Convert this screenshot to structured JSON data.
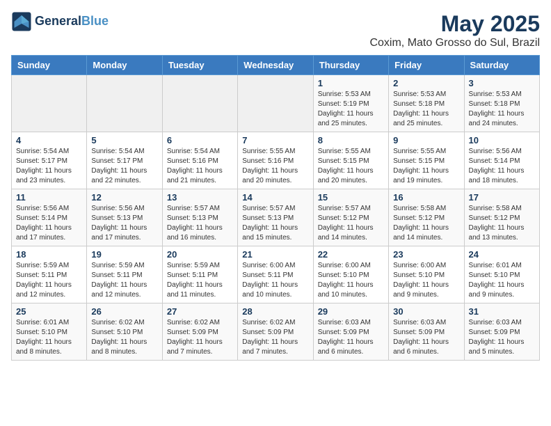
{
  "header": {
    "logo_line1": "General",
    "logo_line2": "Blue",
    "month": "May 2025",
    "location": "Coxim, Mato Grosso do Sul, Brazil"
  },
  "weekdays": [
    "Sunday",
    "Monday",
    "Tuesday",
    "Wednesday",
    "Thursday",
    "Friday",
    "Saturday"
  ],
  "weeks": [
    [
      {
        "day": "",
        "sunrise": "",
        "sunset": "",
        "daylight": ""
      },
      {
        "day": "",
        "sunrise": "",
        "sunset": "",
        "daylight": ""
      },
      {
        "day": "",
        "sunrise": "",
        "sunset": "",
        "daylight": ""
      },
      {
        "day": "",
        "sunrise": "",
        "sunset": "",
        "daylight": ""
      },
      {
        "day": "1",
        "sunrise": "Sunrise: 5:53 AM",
        "sunset": "Sunset: 5:19 PM",
        "daylight": "Daylight: 11 hours and 25 minutes."
      },
      {
        "day": "2",
        "sunrise": "Sunrise: 5:53 AM",
        "sunset": "Sunset: 5:18 PM",
        "daylight": "Daylight: 11 hours and 25 minutes."
      },
      {
        "day": "3",
        "sunrise": "Sunrise: 5:53 AM",
        "sunset": "Sunset: 5:18 PM",
        "daylight": "Daylight: 11 hours and 24 minutes."
      }
    ],
    [
      {
        "day": "4",
        "sunrise": "Sunrise: 5:54 AM",
        "sunset": "Sunset: 5:17 PM",
        "daylight": "Daylight: 11 hours and 23 minutes."
      },
      {
        "day": "5",
        "sunrise": "Sunrise: 5:54 AM",
        "sunset": "Sunset: 5:17 PM",
        "daylight": "Daylight: 11 hours and 22 minutes."
      },
      {
        "day": "6",
        "sunrise": "Sunrise: 5:54 AM",
        "sunset": "Sunset: 5:16 PM",
        "daylight": "Daylight: 11 hours and 21 minutes."
      },
      {
        "day": "7",
        "sunrise": "Sunrise: 5:55 AM",
        "sunset": "Sunset: 5:16 PM",
        "daylight": "Daylight: 11 hours and 20 minutes."
      },
      {
        "day": "8",
        "sunrise": "Sunrise: 5:55 AM",
        "sunset": "Sunset: 5:15 PM",
        "daylight": "Daylight: 11 hours and 20 minutes."
      },
      {
        "day": "9",
        "sunrise": "Sunrise: 5:55 AM",
        "sunset": "Sunset: 5:15 PM",
        "daylight": "Daylight: 11 hours and 19 minutes."
      },
      {
        "day": "10",
        "sunrise": "Sunrise: 5:56 AM",
        "sunset": "Sunset: 5:14 PM",
        "daylight": "Daylight: 11 hours and 18 minutes."
      }
    ],
    [
      {
        "day": "11",
        "sunrise": "Sunrise: 5:56 AM",
        "sunset": "Sunset: 5:14 PM",
        "daylight": "Daylight: 11 hours and 17 minutes."
      },
      {
        "day": "12",
        "sunrise": "Sunrise: 5:56 AM",
        "sunset": "Sunset: 5:13 PM",
        "daylight": "Daylight: 11 hours and 17 minutes."
      },
      {
        "day": "13",
        "sunrise": "Sunrise: 5:57 AM",
        "sunset": "Sunset: 5:13 PM",
        "daylight": "Daylight: 11 hours and 16 minutes."
      },
      {
        "day": "14",
        "sunrise": "Sunrise: 5:57 AM",
        "sunset": "Sunset: 5:13 PM",
        "daylight": "Daylight: 11 hours and 15 minutes."
      },
      {
        "day": "15",
        "sunrise": "Sunrise: 5:57 AM",
        "sunset": "Sunset: 5:12 PM",
        "daylight": "Daylight: 11 hours and 14 minutes."
      },
      {
        "day": "16",
        "sunrise": "Sunrise: 5:58 AM",
        "sunset": "Sunset: 5:12 PM",
        "daylight": "Daylight: 11 hours and 14 minutes."
      },
      {
        "day": "17",
        "sunrise": "Sunrise: 5:58 AM",
        "sunset": "Sunset: 5:12 PM",
        "daylight": "Daylight: 11 hours and 13 minutes."
      }
    ],
    [
      {
        "day": "18",
        "sunrise": "Sunrise: 5:59 AM",
        "sunset": "Sunset: 5:11 PM",
        "daylight": "Daylight: 11 hours and 12 minutes."
      },
      {
        "day": "19",
        "sunrise": "Sunrise: 5:59 AM",
        "sunset": "Sunset: 5:11 PM",
        "daylight": "Daylight: 11 hours and 12 minutes."
      },
      {
        "day": "20",
        "sunrise": "Sunrise: 5:59 AM",
        "sunset": "Sunset: 5:11 PM",
        "daylight": "Daylight: 11 hours and 11 minutes."
      },
      {
        "day": "21",
        "sunrise": "Sunrise: 6:00 AM",
        "sunset": "Sunset: 5:11 PM",
        "daylight": "Daylight: 11 hours and 10 minutes."
      },
      {
        "day": "22",
        "sunrise": "Sunrise: 6:00 AM",
        "sunset": "Sunset: 5:10 PM",
        "daylight": "Daylight: 11 hours and 10 minutes."
      },
      {
        "day": "23",
        "sunrise": "Sunrise: 6:00 AM",
        "sunset": "Sunset: 5:10 PM",
        "daylight": "Daylight: 11 hours and 9 minutes."
      },
      {
        "day": "24",
        "sunrise": "Sunrise: 6:01 AM",
        "sunset": "Sunset: 5:10 PM",
        "daylight": "Daylight: 11 hours and 9 minutes."
      }
    ],
    [
      {
        "day": "25",
        "sunrise": "Sunrise: 6:01 AM",
        "sunset": "Sunset: 5:10 PM",
        "daylight": "Daylight: 11 hours and 8 minutes."
      },
      {
        "day": "26",
        "sunrise": "Sunrise: 6:02 AM",
        "sunset": "Sunset: 5:10 PM",
        "daylight": "Daylight: 11 hours and 8 minutes."
      },
      {
        "day": "27",
        "sunrise": "Sunrise: 6:02 AM",
        "sunset": "Sunset: 5:09 PM",
        "daylight": "Daylight: 11 hours and 7 minutes."
      },
      {
        "day": "28",
        "sunrise": "Sunrise: 6:02 AM",
        "sunset": "Sunset: 5:09 PM",
        "daylight": "Daylight: 11 hours and 7 minutes."
      },
      {
        "day": "29",
        "sunrise": "Sunrise: 6:03 AM",
        "sunset": "Sunset: 5:09 PM",
        "daylight": "Daylight: 11 hours and 6 minutes."
      },
      {
        "day": "30",
        "sunrise": "Sunrise: 6:03 AM",
        "sunset": "Sunset: 5:09 PM",
        "daylight": "Daylight: 11 hours and 6 minutes."
      },
      {
        "day": "31",
        "sunrise": "Sunrise: 6:03 AM",
        "sunset": "Sunset: 5:09 PM",
        "daylight": "Daylight: 11 hours and 5 minutes."
      }
    ]
  ]
}
